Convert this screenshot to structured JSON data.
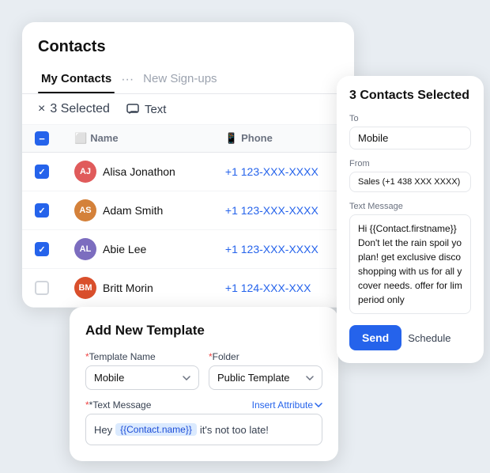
{
  "contacts_card": {
    "title": "Contacts",
    "tabs": [
      {
        "label": "My Contacts",
        "active": true
      },
      {
        "label": "New Sign-ups",
        "active": false
      }
    ],
    "dots": "···",
    "selection": {
      "close_icon": "×",
      "count": "3 Selected",
      "text_button": "Text"
    },
    "table": {
      "headers": [
        "",
        "Name",
        "Phone"
      ],
      "rows": [
        {
          "checked": true,
          "name": "Alisa Jonathon",
          "phone": "+1 123-XXX-XXXX",
          "avatar_color": "#e05b5b",
          "initials": "AJ"
        },
        {
          "checked": true,
          "name": "Adam Smith",
          "phone": "+1 123-XXX-XXXX",
          "avatar_color": "#d4813a",
          "initials": "AS"
        },
        {
          "checked": true,
          "name": "Abie Lee",
          "phone": "+1 123-XXX-XXXX",
          "avatar_color": "#7c6dbf",
          "initials": "AL"
        },
        {
          "checked": false,
          "name": "Britt Morin",
          "phone": "+1 124-XXX-XXX",
          "avatar_color": "#d94f2c",
          "initials": "BM"
        }
      ]
    }
  },
  "template_card": {
    "title": "Add New Template",
    "template_name_label": "*Template Name",
    "template_name_value": "Mobile",
    "folder_label": "*Folder",
    "folder_value": "Public Template",
    "text_message_label": "*Text Message",
    "insert_attribute_label": "Insert Attribute",
    "message_prefix": "Hey",
    "message_tag": "{{Contact.name}}",
    "message_suffix": "it's not too late!"
  },
  "right_panel": {
    "heading": "3 Contacts Selected",
    "to_label": "To",
    "to_value": "Mobile",
    "from_label": "From",
    "from_value": "Sales (+1 438 XXX XXXX)",
    "text_message_label": "Text Message",
    "text_message_content": "Hi {{Contact.firstname}} Don't let the rain spoil yo plan! get exclusive disco shopping with us for all y cover needs. offer for lim period only",
    "send_button": "Send",
    "schedule_button": "Schedule"
  }
}
